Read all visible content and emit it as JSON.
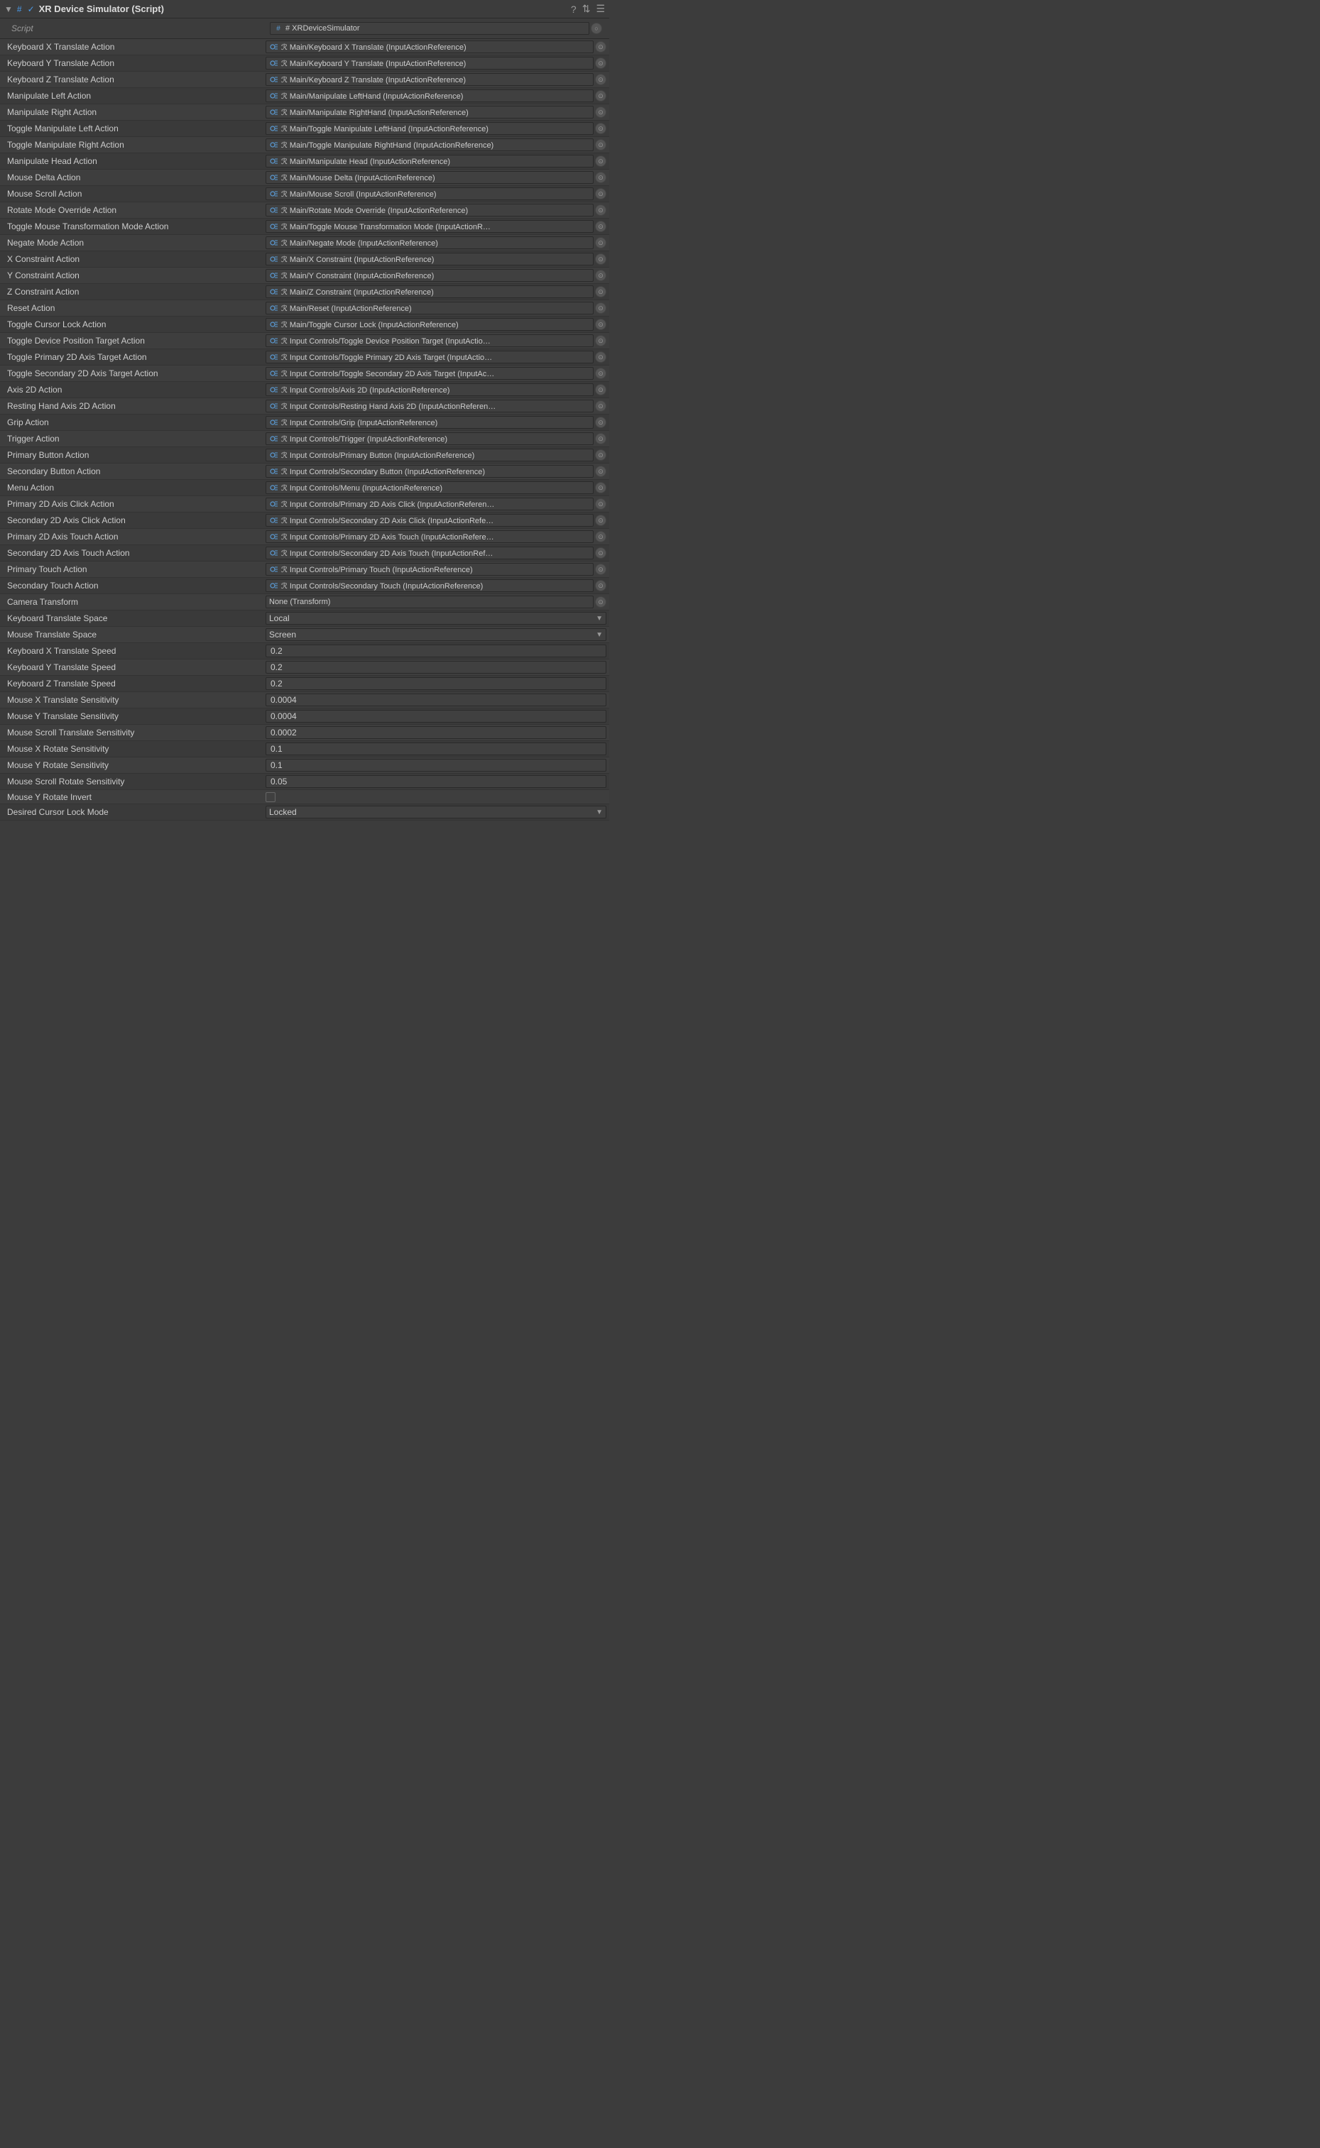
{
  "header": {
    "title": "XR Device Simulator (Script)",
    "icons": [
      "?",
      "≡",
      "☰"
    ]
  },
  "script_row": {
    "label": "Script",
    "value": "# XRDeviceSimulator"
  },
  "rows": [
    {
      "label": "Keyboard X Translate Action",
      "type": "ref",
      "value": "ℛ Main/Keyboard X Translate (InputActionReference)"
    },
    {
      "label": "Keyboard Y Translate Action",
      "type": "ref",
      "value": "ℛ Main/Keyboard Y Translate (InputActionReference)"
    },
    {
      "label": "Keyboard Z Translate Action",
      "type": "ref",
      "value": "ℛ Main/Keyboard Z Translate (InputActionReference)"
    },
    {
      "label": "Manipulate Left Action",
      "type": "ref",
      "value": "ℛ Main/Manipulate LeftHand (InputActionReference)"
    },
    {
      "label": "Manipulate Right Action",
      "type": "ref",
      "value": "ℛ Main/Manipulate RightHand (InputActionReference)"
    },
    {
      "label": "Toggle Manipulate Left Action",
      "type": "ref",
      "value": "ℛ Main/Toggle Manipulate LeftHand (InputActionReference)"
    },
    {
      "label": "Toggle Manipulate Right Action",
      "type": "ref",
      "value": "ℛ Main/Toggle Manipulate RightHand (InputActionReference)"
    },
    {
      "label": "Manipulate Head Action",
      "type": "ref",
      "value": "ℛ Main/Manipulate Head (InputActionReference)"
    },
    {
      "label": "Mouse Delta Action",
      "type": "ref",
      "value": "ℛ Main/Mouse Delta (InputActionReference)"
    },
    {
      "label": "Mouse Scroll Action",
      "type": "ref",
      "value": "ℛ Main/Mouse Scroll (InputActionReference)"
    },
    {
      "label": "Rotate Mode Override Action",
      "type": "ref",
      "value": "ℛ Main/Rotate Mode Override (InputActionReference)"
    },
    {
      "label": "Toggle Mouse Transformation Mode Action",
      "type": "ref",
      "value": "ℛ Main/Toggle Mouse Transformation Mode (InputActionR…"
    },
    {
      "label": "Negate Mode Action",
      "type": "ref",
      "value": "ℛ Main/Negate Mode (InputActionReference)"
    },
    {
      "label": "X Constraint Action",
      "type": "ref",
      "value": "ℛ Main/X Constraint (InputActionReference)"
    },
    {
      "label": "Y Constraint Action",
      "type": "ref",
      "value": "ℛ Main/Y Constraint (InputActionReference)"
    },
    {
      "label": "Z Constraint Action",
      "type": "ref",
      "value": "ℛ Main/Z Constraint (InputActionReference)"
    },
    {
      "label": "Reset Action",
      "type": "ref",
      "value": "ℛ Main/Reset (InputActionReference)"
    },
    {
      "label": "Toggle Cursor Lock Action",
      "type": "ref",
      "value": "ℛ Main/Toggle Cursor Lock (InputActionReference)"
    },
    {
      "label": "Toggle Device Position Target Action",
      "type": "ref",
      "value": "ℛ Input Controls/Toggle Device Position Target (InputActio…"
    },
    {
      "label": "Toggle Primary 2D Axis Target Action",
      "type": "ref",
      "value": "ℛ Input Controls/Toggle Primary 2D Axis Target (InputActio…"
    },
    {
      "label": "Toggle Secondary 2D Axis Target Action",
      "type": "ref",
      "value": "ℛ Input Controls/Toggle Secondary 2D Axis Target (InputAc…"
    },
    {
      "label": "Axis 2D Action",
      "type": "ref",
      "value": "ℛ Input Controls/Axis 2D (InputActionReference)"
    },
    {
      "label": "Resting Hand Axis 2D Action",
      "type": "ref",
      "value": "ℛ Input Controls/Resting Hand Axis 2D (InputActionReferen…"
    },
    {
      "label": "Grip Action",
      "type": "ref",
      "value": "ℛ Input Controls/Grip (InputActionReference)"
    },
    {
      "label": "Trigger Action",
      "type": "ref",
      "value": "ℛ Input Controls/Trigger (InputActionReference)"
    },
    {
      "label": "Primary Button Action",
      "type": "ref",
      "value": "ℛ Input Controls/Primary Button (InputActionReference)"
    },
    {
      "label": "Secondary Button Action",
      "type": "ref",
      "value": "ℛ Input Controls/Secondary Button (InputActionReference)"
    },
    {
      "label": "Menu Action",
      "type": "ref",
      "value": "ℛ Input Controls/Menu (InputActionReference)"
    },
    {
      "label": "Primary 2D Axis Click Action",
      "type": "ref",
      "value": "ℛ Input Controls/Primary 2D Axis Click (InputActionReferen…"
    },
    {
      "label": "Secondary 2D Axis Click Action",
      "type": "ref",
      "value": "ℛ Input Controls/Secondary 2D Axis Click (InputActionRefe…"
    },
    {
      "label": "Primary 2D Axis Touch Action",
      "type": "ref",
      "value": "ℛ Input Controls/Primary 2D Axis Touch (InputActionRefere…"
    },
    {
      "label": "Secondary 2D Axis Touch Action",
      "type": "ref",
      "value": "ℛ Input Controls/Secondary 2D Axis Touch (InputActionRef…"
    },
    {
      "label": "Primary Touch Action",
      "type": "ref",
      "value": "ℛ Input Controls/Primary Touch (InputActionReference)"
    },
    {
      "label": "Secondary Touch Action",
      "type": "ref",
      "value": "ℛ Input Controls/Secondary Touch (InputActionReference)"
    },
    {
      "label": "Camera Transform",
      "type": "ref-none",
      "value": "None (Transform)"
    },
    {
      "label": "Keyboard Translate Space",
      "type": "dropdown",
      "value": "Local"
    },
    {
      "label": "Mouse Translate Space",
      "type": "dropdown",
      "value": "Screen"
    },
    {
      "label": "Keyboard X Translate Speed",
      "type": "number",
      "value": "0.2"
    },
    {
      "label": "Keyboard Y Translate Speed",
      "type": "number",
      "value": "0.2"
    },
    {
      "label": "Keyboard Z Translate Speed",
      "type": "number",
      "value": "0.2"
    },
    {
      "label": "Mouse X Translate Sensitivity",
      "type": "number",
      "value": "0.0004"
    },
    {
      "label": "Mouse Y Translate Sensitivity",
      "type": "number",
      "value": "0.0004"
    },
    {
      "label": "Mouse Scroll Translate Sensitivity",
      "type": "number",
      "value": "0.0002"
    },
    {
      "label": "Mouse X Rotate Sensitivity",
      "type": "number",
      "value": "0.1"
    },
    {
      "label": "Mouse Y Rotate Sensitivity",
      "type": "number",
      "value": "0.1"
    },
    {
      "label": "Mouse Scroll Rotate Sensitivity",
      "type": "number",
      "value": "0.05"
    },
    {
      "label": "Mouse Y Rotate Invert",
      "type": "checkbox",
      "value": false
    },
    {
      "label": "Desired Cursor Lock Mode",
      "type": "dropdown",
      "value": "Locked"
    }
  ]
}
